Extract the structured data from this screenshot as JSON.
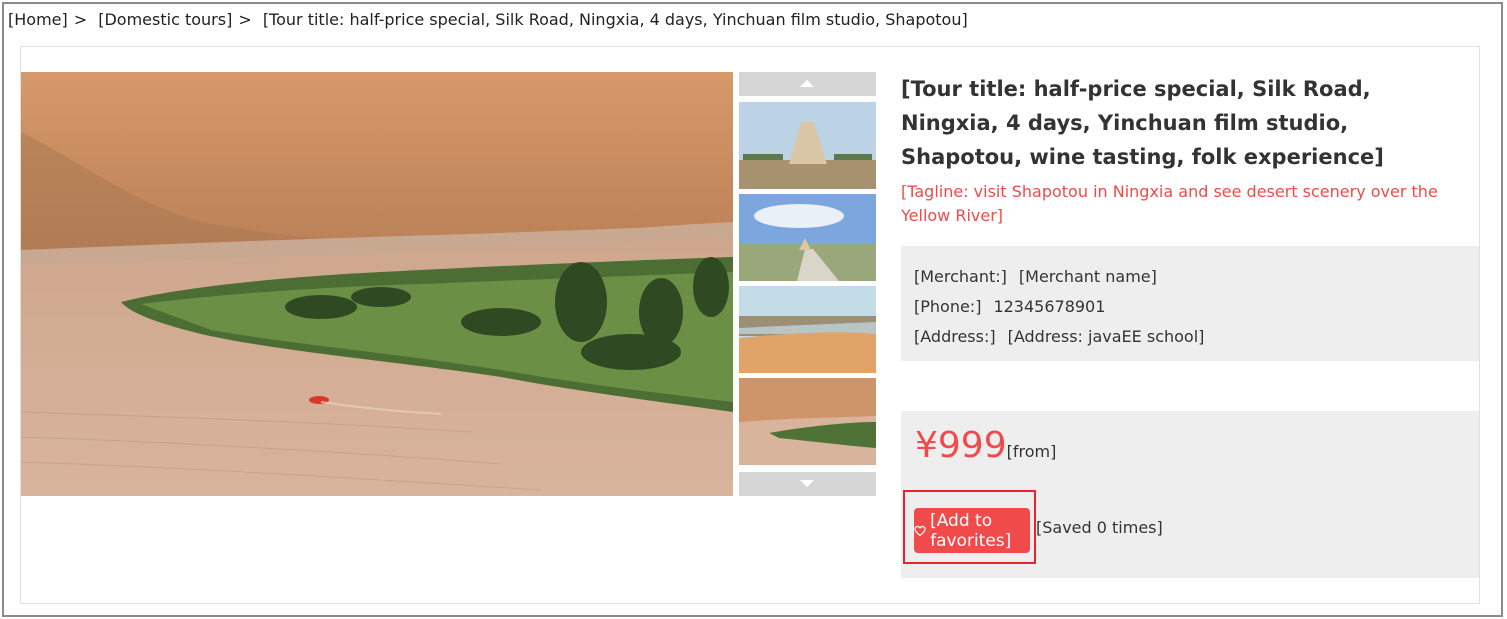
{
  "breadcrumb": {
    "home": "[Home]",
    "separator": ">",
    "category": "[Domestic tours]",
    "current": "[Tour title: half-price special, Silk Road, Ningxia, 4 days, Yinchuan film studio, Shapotou]"
  },
  "gallery": {
    "main_image": "yellow-river-shapotou-landscape",
    "thumbnails": [
      "western-xia-tomb-thumbnail",
      "western-xia-tomb-road-thumbnail",
      "desert-dunes-river-thumbnail",
      "yellow-river-desert-thumbnail"
    ],
    "up_icon": "arrow-up-icon",
    "down_icon": "arrow-down-icon"
  },
  "product": {
    "title": "[Tour title: half-price special, Silk Road, Ningxia, 4 days, Yinchuan film studio, Shapotou, wine tasting, folk experience]",
    "subtitle": "[Tagline: visit Shapotou in Ningxia and see desert scenery over the Yellow River]"
  },
  "merchant": {
    "seller_label": "[Merchant:]",
    "seller_value": "[Merchant name]",
    "phone_label": "[Phone:]",
    "phone_value": "12345678901",
    "address_label": "[Address:]",
    "address_value": "[Address: javaEE school]"
  },
  "price": {
    "currency": "¥",
    "amount": "999",
    "suffix": "[from]"
  },
  "favorite": {
    "button_label": "[Add to favorites]",
    "icon": "heart-icon",
    "count_text": "[Saved 0 times]"
  },
  "colors": {
    "accent": "#f04a4a",
    "highlight_border": "#e8222e",
    "info_bg": "#eeeeee"
  }
}
